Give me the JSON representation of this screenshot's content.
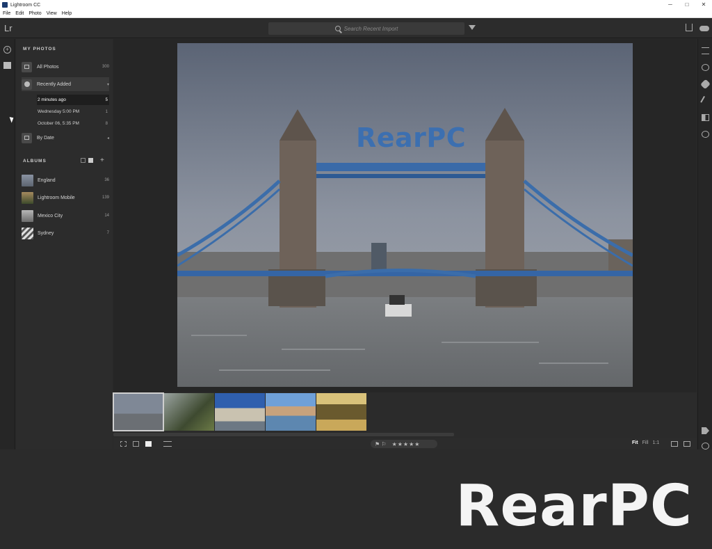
{
  "window": {
    "title": "Lightroom CC",
    "controls": [
      "─",
      "□",
      "✕"
    ]
  },
  "menu": [
    "File",
    "Edit",
    "Photo",
    "View",
    "Help"
  ],
  "header": {
    "logo": "Lr",
    "search_placeholder": "Search Recent Import"
  },
  "left_panel": {
    "my_photos_title": "MY PHOTOS",
    "all_photos": {
      "label": "All Photos",
      "count": "300"
    },
    "recently_added": {
      "label": "Recently Added",
      "chevron": "▾"
    },
    "recent_items": [
      {
        "label": "2 minutes ago",
        "count": "5"
      },
      {
        "label": "Wednesday  5:00 PM",
        "count": "1"
      },
      {
        "label": "October 06, 5:35 PM",
        "count": "8"
      }
    ],
    "by_date": {
      "label": "By Date",
      "chevron": "◂"
    },
    "albums_title": "ALBUMS",
    "albums": [
      {
        "label": "England",
        "count": "36"
      },
      {
        "label": "Lightroom Mobile",
        "count": "139"
      },
      {
        "label": "Mexico City",
        "count": "14"
      },
      {
        "label": "Sydney",
        "count": "7"
      }
    ]
  },
  "viewer": {
    "watermark": "RearPC"
  },
  "toolbar": {
    "flags": "⚑ ⚐",
    "stars": "★★★★★",
    "zoom": {
      "fit": "Fit",
      "fill": "Fill",
      "one_to_one": "1:1"
    }
  },
  "band": {
    "watermark": "RearPC"
  }
}
